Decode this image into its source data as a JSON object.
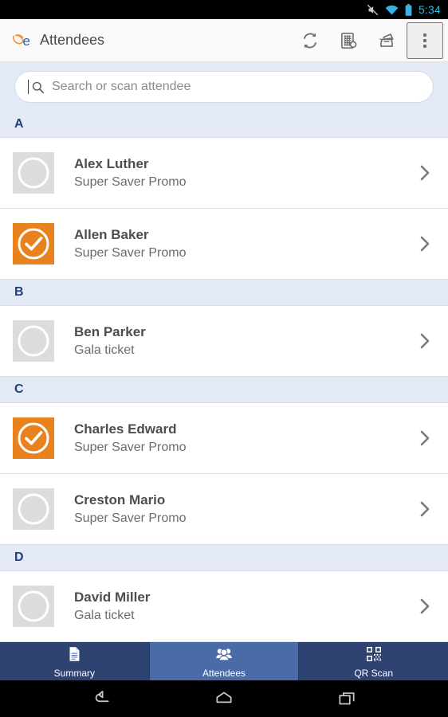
{
  "statusbar": {
    "time": "5:34",
    "icons": [
      "mute-icon",
      "wifi-icon",
      "battery-icon"
    ]
  },
  "appbar": {
    "logo_name": "eventbrite-logo",
    "title": "Attendees",
    "actions": [
      {
        "name": "sync-icon",
        "label": "Sync"
      },
      {
        "name": "order-lookup-icon",
        "label": "Orders"
      },
      {
        "name": "ticket-icon",
        "label": "Tickets"
      },
      {
        "name": "overflow-menu-icon",
        "label": "More options"
      }
    ]
  },
  "search": {
    "placeholder": "Search or scan attendee",
    "value": "",
    "icon": "search-icon"
  },
  "colors": {
    "accent_orange": "#e8821e",
    "section_header_text": "#21417e",
    "section_header_bg": "#e4e9f6",
    "tab_bg": "#2e4372",
    "tab_active_bg": "#4b6aa8",
    "status_clock": "#33b5e5"
  },
  "list": {
    "sections": [
      {
        "letter": "A",
        "attendees": [
          {
            "name": "Alex Luther",
            "ticket": "Super Saver Promo",
            "checked_in": false
          },
          {
            "name": "Allen Baker",
            "ticket": "Super Saver Promo",
            "checked_in": true
          }
        ]
      },
      {
        "letter": "B",
        "attendees": [
          {
            "name": "Ben Parker",
            "ticket": "Gala ticket",
            "checked_in": false
          }
        ]
      },
      {
        "letter": "C",
        "attendees": [
          {
            "name": "Charles Edward",
            "ticket": "Super Saver Promo",
            "checked_in": true
          },
          {
            "name": "Creston Mario",
            "ticket": "Super Saver Promo",
            "checked_in": false
          }
        ]
      },
      {
        "letter": "D",
        "attendees": [
          {
            "name": "David Miller",
            "ticket": "Gala ticket",
            "checked_in": false
          }
        ]
      }
    ]
  },
  "tabs": [
    {
      "label": "Summary",
      "icon": "document-icon",
      "active": false
    },
    {
      "label": "Attendees",
      "icon": "people-icon",
      "active": true
    },
    {
      "label": "QR Scan",
      "icon": "qr-code-icon",
      "active": false
    }
  ],
  "navbar": {
    "buttons": [
      {
        "name": "back-icon",
        "label": "Back"
      },
      {
        "name": "home-icon",
        "label": "Home"
      },
      {
        "name": "recents-icon",
        "label": "Recents"
      }
    ]
  }
}
